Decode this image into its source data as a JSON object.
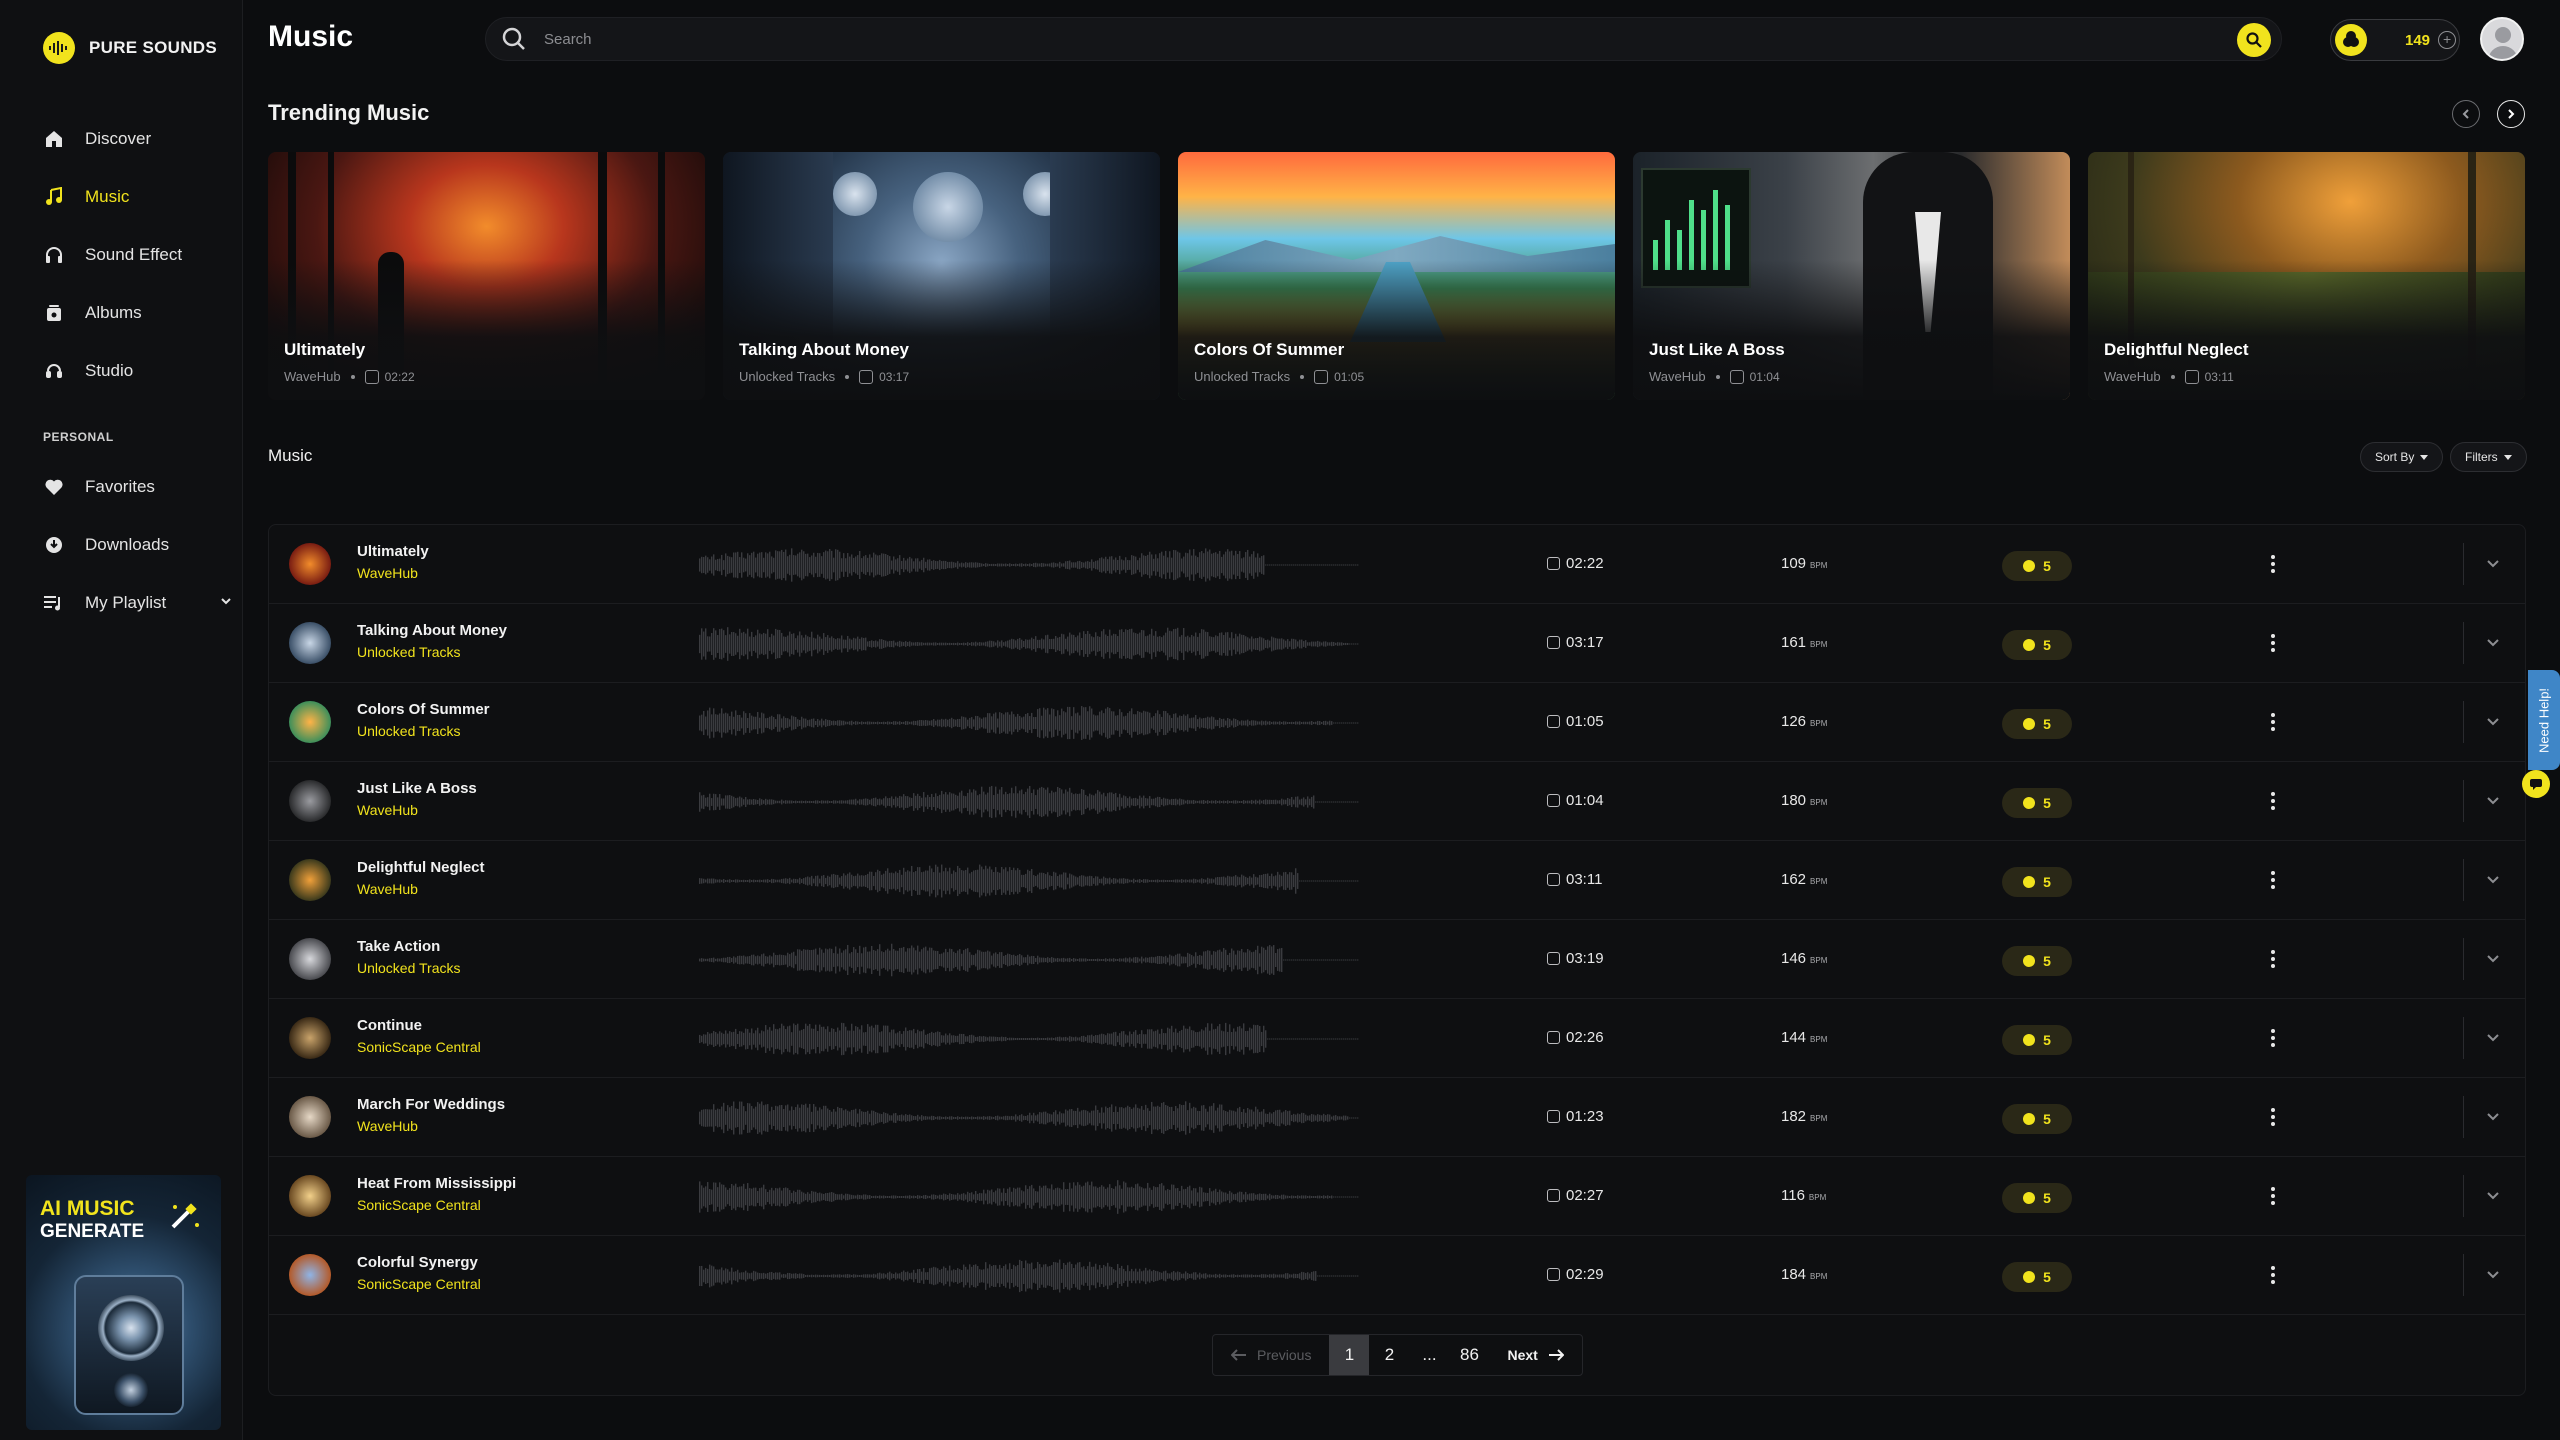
{
  "brand": {
    "name": "PURE SOUNDS"
  },
  "nav": [
    {
      "label": "Discover",
      "icon": "home-icon",
      "active": false
    },
    {
      "label": "Music",
      "icon": "music-note-icon",
      "active": true
    },
    {
      "label": "Sound Effect",
      "icon": "headphones-icon",
      "active": false
    },
    {
      "label": "Albums",
      "icon": "album-icon",
      "active": false
    },
    {
      "label": "Studio",
      "icon": "studio-icon",
      "active": false
    }
  ],
  "personal": {
    "label": "PERSONAL",
    "items": [
      {
        "label": "Favorites",
        "icon": "heart-icon"
      },
      {
        "label": "Downloads",
        "icon": "download-icon"
      },
      {
        "label": "My Playlist",
        "icon": "playlist-icon"
      }
    ]
  },
  "promo": {
    "line1": "AI MUSIC",
    "line2": "GENERATE"
  },
  "header": {
    "title": "Music",
    "search_placeholder": "Search",
    "credits": "149"
  },
  "trending": {
    "title": "Trending Music",
    "cards": [
      {
        "title": "Ultimately",
        "artist": "WaveHub",
        "duration": "02:22"
      },
      {
        "title": "Talking About Money",
        "artist": "Unlocked Tracks",
        "duration": "03:17"
      },
      {
        "title": "Colors Of Summer",
        "artist": "Unlocked Tracks",
        "duration": "01:05"
      },
      {
        "title": "Just Like A Boss",
        "artist": "WaveHub",
        "duration": "01:04"
      },
      {
        "title": "Delightful Neglect",
        "artist": "WaveHub",
        "duration": "03:11"
      }
    ]
  },
  "music": {
    "label": "Music",
    "sort_label": "Sort By",
    "filter_label": "Filters",
    "bpm_unit": "BPM",
    "tracks": [
      {
        "title": "Ultimately",
        "artist": "WaveHub",
        "duration": "02:22",
        "bpm": "109",
        "credits": "5"
      },
      {
        "title": "Talking About Money",
        "artist": "Unlocked Tracks",
        "duration": "03:17",
        "bpm": "161",
        "credits": "5"
      },
      {
        "title": "Colors Of Summer",
        "artist": "Unlocked Tracks",
        "duration": "01:05",
        "bpm": "126",
        "credits": "5"
      },
      {
        "title": "Just Like A Boss",
        "artist": "WaveHub",
        "duration": "01:04",
        "bpm": "180",
        "credits": "5"
      },
      {
        "title": "Delightful Neglect",
        "artist": "WaveHub",
        "duration": "03:11",
        "bpm": "162",
        "credits": "5"
      },
      {
        "title": "Take Action",
        "artist": "Unlocked Tracks",
        "duration": "03:19",
        "bpm": "146",
        "credits": "5"
      },
      {
        "title": "Continue",
        "artist": "SonicScape Central",
        "duration": "02:26",
        "bpm": "144",
        "credits": "5"
      },
      {
        "title": "March For Weddings",
        "artist": "WaveHub",
        "duration": "01:23",
        "bpm": "182",
        "credits": "5"
      },
      {
        "title": "Heat From Mississippi",
        "artist": "SonicScape Central",
        "duration": "02:27",
        "bpm": "116",
        "credits": "5"
      },
      {
        "title": "Colorful Synergy",
        "artist": "SonicScape Central",
        "duration": "02:29",
        "bpm": "184",
        "credits": "5"
      }
    ]
  },
  "pagination": {
    "prev": "Previous",
    "next": "Next",
    "pages": [
      "1",
      "2",
      "...",
      "86"
    ],
    "current": "1"
  },
  "help": {
    "label": "Need Help!"
  },
  "colors": {
    "accent": "#f1e31d",
    "background": "#0c0d0f",
    "sidebar": "#0f1012",
    "help": "#3f86c7"
  }
}
